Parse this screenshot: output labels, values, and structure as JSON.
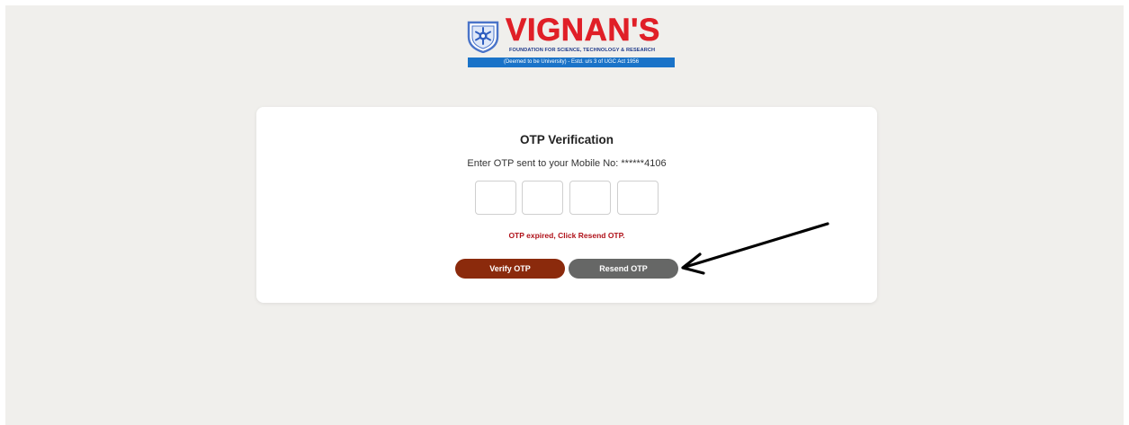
{
  "logo": {
    "name": "VIGNAN'S",
    "tagline": "FOUNDATION FOR SCIENCE, TECHNOLOGY & RESEARCH",
    "banner": "(Deemed to be University) - Estd. u/s 3 of UGC Act 1956",
    "emblem_icon": "university-emblem-icon"
  },
  "otp": {
    "title": "OTP Verification",
    "subtitle": "Enter OTP sent to your Mobile No: ******4106",
    "digits": [
      "",
      "",
      "",
      ""
    ],
    "error": "OTP expired, Click Resend OTP."
  },
  "buttons": {
    "verify_label": "Verify OTP",
    "resend_label": "Resend OTP"
  },
  "annotation": {
    "arrow_icon": "pointer-arrow-icon"
  },
  "colors": {
    "page_bg": "#f0efec",
    "brand_red": "#e01f27",
    "verify_button": "#8b2a0c",
    "resend_button": "#666766",
    "error_text": "#b0121a",
    "banner_blue": "#1a73c8"
  }
}
